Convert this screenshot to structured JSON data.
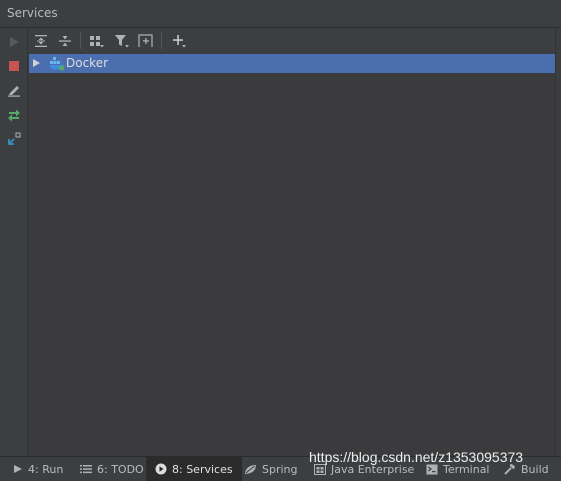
{
  "window": {
    "title": "Services"
  },
  "left_toolbar": [
    {
      "name": "run-icon"
    },
    {
      "name": "stop-icon"
    },
    {
      "name": "edit-icon"
    },
    {
      "name": "deploy-icon"
    },
    {
      "name": "restore-layout-icon"
    }
  ],
  "top_toolbar": [
    {
      "name": "expand-all-icon"
    },
    {
      "name": "collapse-all-icon"
    },
    {
      "name": "group-by-icon"
    },
    {
      "name": "filter-icon"
    },
    {
      "name": "new-tab-icon"
    },
    {
      "name": "add-service-icon"
    }
  ],
  "tree": {
    "items": [
      {
        "label": "Docker",
        "icon": "docker-icon",
        "expanded": false,
        "selected": true
      }
    ]
  },
  "bottom_bar": {
    "items": [
      {
        "label": "4: Run",
        "icon": "run-tool-icon",
        "active": false
      },
      {
        "label": "6: TODO",
        "icon": "todo-icon",
        "active": false
      },
      {
        "label": "8: Services",
        "icon": "services-icon",
        "active": true
      },
      {
        "label": "Spring",
        "icon": "spring-icon",
        "active": false
      },
      {
        "label": "Java Enterprise",
        "icon": "java-enterprise-icon",
        "active": false
      },
      {
        "label": "Terminal",
        "icon": "terminal-icon",
        "active": false
      },
      {
        "label": "Build",
        "icon": "build-icon",
        "active": false
      }
    ]
  },
  "watermark": "https://blog.csdn.net/z1353095373",
  "colors": {
    "selection": "#4b6eaf",
    "background": "#3c3f41",
    "tree_background": "#3b3b3d"
  }
}
